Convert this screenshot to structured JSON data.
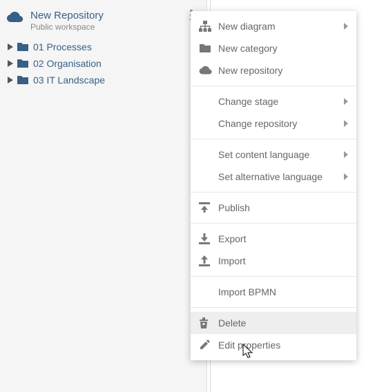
{
  "repo": {
    "title": "New Repository",
    "subtitle": "Public workspace"
  },
  "tree": {
    "items": [
      {
        "label": "01 Processes"
      },
      {
        "label": "02 Organisation"
      },
      {
        "label": "03 IT Landscape"
      }
    ]
  },
  "menu": {
    "new_diagram": "New diagram",
    "new_category": "New category",
    "new_repository": "New repository",
    "change_stage": "Change stage",
    "change_repository": "Change repository",
    "set_content_language": "Set content language",
    "set_alternative_language": "Set alternative language",
    "publish": "Publish",
    "export": "Export",
    "import": "Import",
    "import_bpmn": "Import BPMN",
    "delete": "Delete",
    "edit_properties": "Edit properties"
  }
}
